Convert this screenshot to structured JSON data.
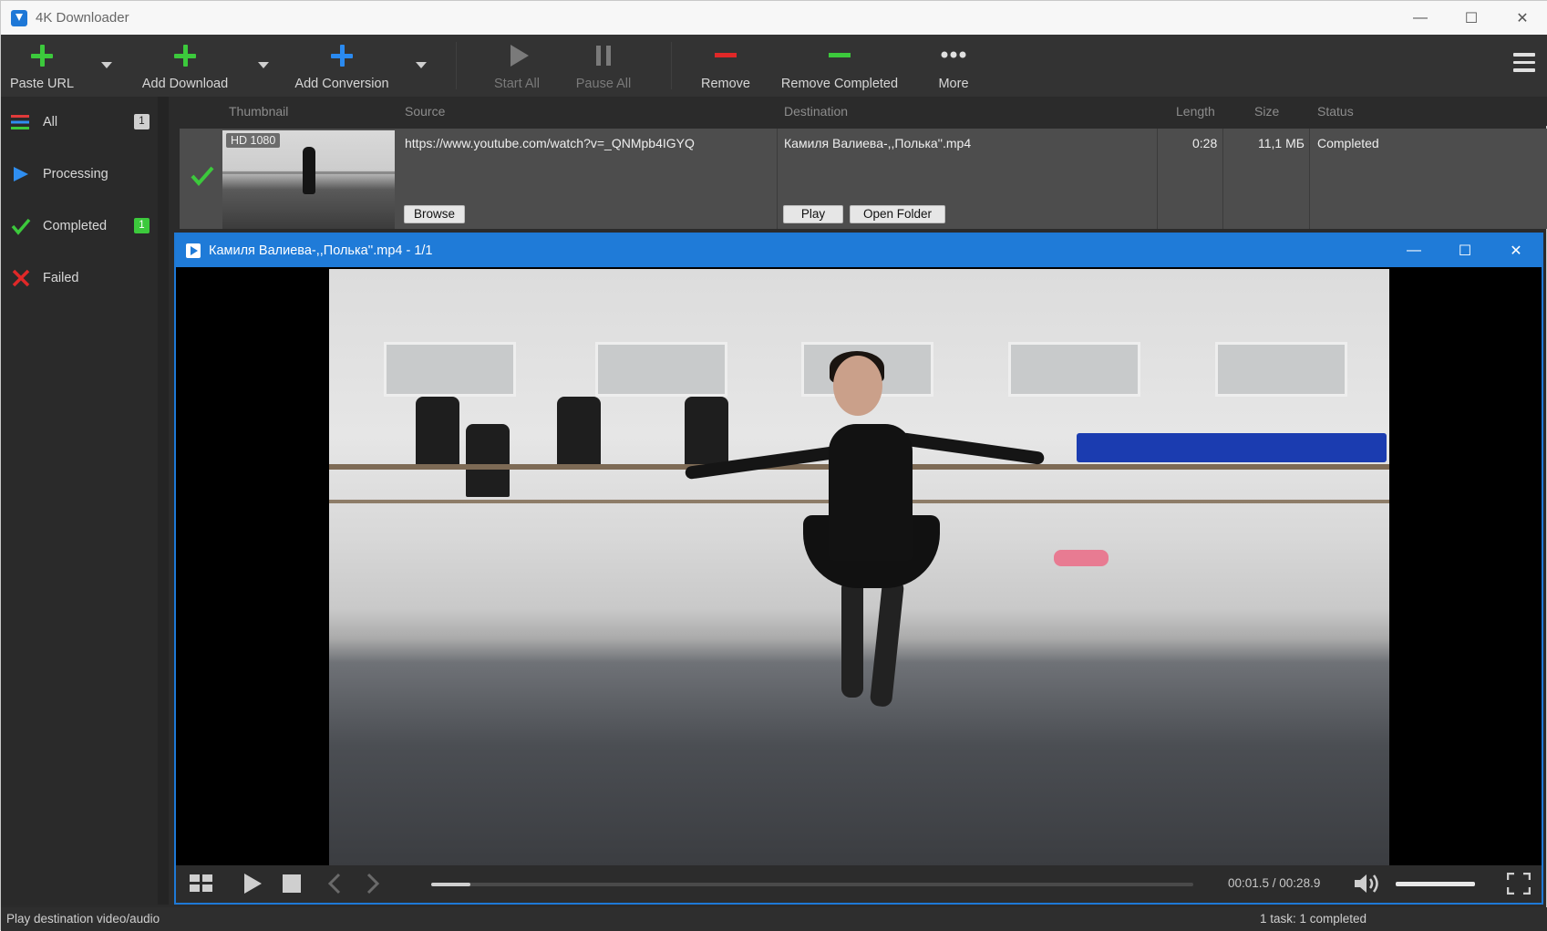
{
  "window": {
    "title": "4K Downloader"
  },
  "toolbar": {
    "paste_url": "Paste URL",
    "add_download": "Add Download",
    "add_conversion": "Add Conversion",
    "start_all": "Start All",
    "pause_all": "Pause All",
    "remove": "Remove",
    "remove_completed": "Remove Completed",
    "more": "More"
  },
  "sidebar": {
    "items": [
      {
        "label": "All",
        "count": "1"
      },
      {
        "label": "Processing"
      },
      {
        "label": "Completed",
        "count": "1"
      },
      {
        "label": "Failed"
      }
    ]
  },
  "columns": {
    "thumbnail": "Thumbnail",
    "source": "Source",
    "destination": "Destination",
    "length": "Length",
    "size": "Size",
    "status": "Status"
  },
  "downloads": [
    {
      "quality": "HD 1080",
      "source": "https://www.youtube.com/watch?v=_QNMpb4IGYQ",
      "destination": "Камиля Валиева-,,Полька''.mp4",
      "length": "0:28",
      "size": "11,1 МБ",
      "status": "Completed",
      "browse": "Browse",
      "play": "Play",
      "open_folder": "Open Folder"
    }
  ],
  "player": {
    "title": "Камиля Валиева-,,Полька''.mp4 - 1/1",
    "time": "00:01.5 / 00:28.9",
    "progress": 0.052,
    "volume": 1.0
  },
  "statusbar": {
    "hint": "Play destination video/audio",
    "summary": "1 task: 1 completed"
  },
  "colors": {
    "accent": "#1f7bd8",
    "add_green": "#3cc93c",
    "add_blue": "#2a8af0",
    "remove_red": "#e02828"
  }
}
